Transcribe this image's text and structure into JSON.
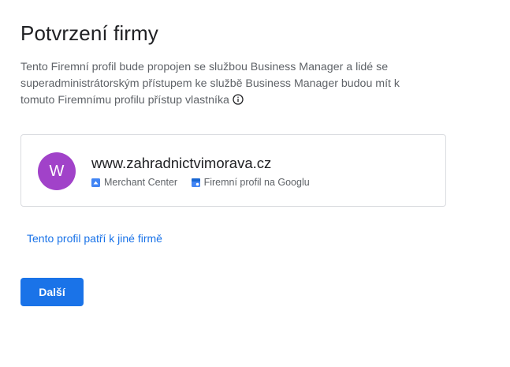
{
  "page": {
    "title": "Potvrzení firmy",
    "description": "Tento Firemní profil bude propojen se službou Business Manager a lidé se superadministrátorským přístupem ke službě Business Manager budou mít k tomuto Firemnímu profilu přístup vlastníka",
    "info_icon": "info-icon"
  },
  "business_card": {
    "avatar_letter": "W",
    "avatar_color": "#a142c9",
    "domain": "www.zahradnictvimorava.cz",
    "sources": [
      {
        "icon": "merchant-center-icon",
        "label": "Merchant Center"
      },
      {
        "icon": "business-profile-icon",
        "label": "Firemní profil na Googlu"
      }
    ]
  },
  "actions": {
    "other_business_link": "Tento profil patří k jiné firmě",
    "next_button": "Další"
  },
  "colors": {
    "accent": "#1a73e8",
    "border": "#dadce0",
    "secondary_text": "#5f6368"
  }
}
